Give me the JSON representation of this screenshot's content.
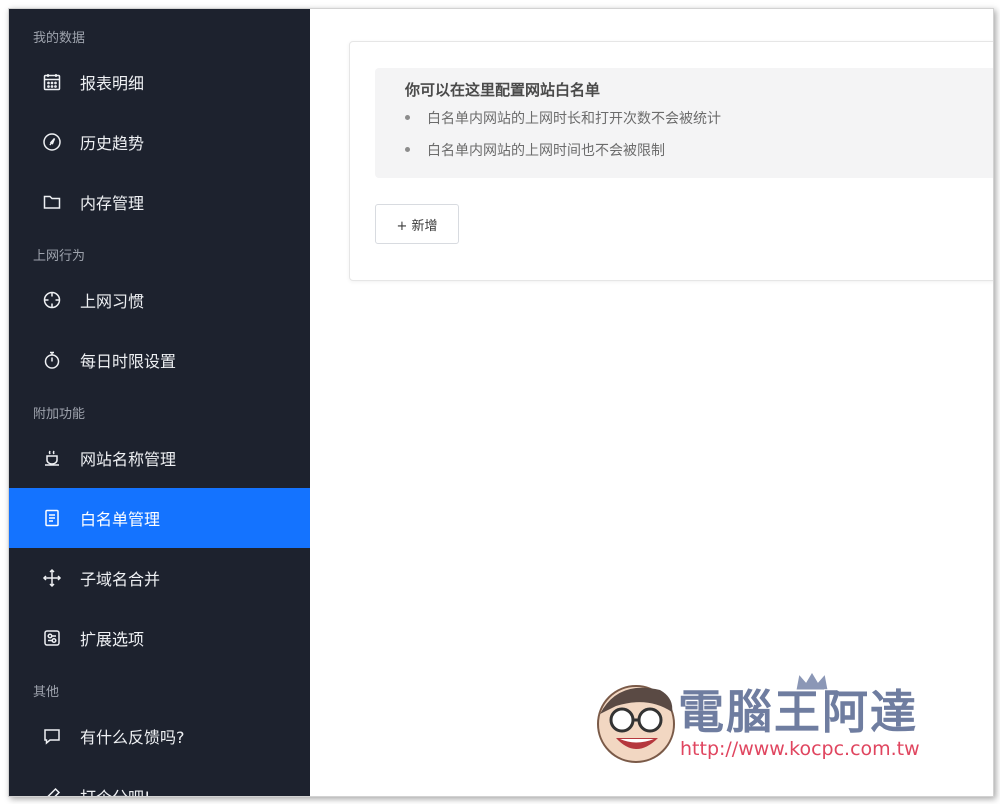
{
  "sidebar": {
    "groups": {
      "my_data": "我的数据",
      "browsing": "上网行为",
      "addons": "附加功能",
      "other": "其他"
    },
    "items": [
      {
        "label": "报表明细",
        "icon": "calendar-icon"
      },
      {
        "label": "历史趋势",
        "icon": "compass-icon"
      },
      {
        "label": "内存管理",
        "icon": "folder-icon"
      },
      {
        "label": "上网习惯",
        "icon": "crosshair-icon"
      },
      {
        "label": "每日时限设置",
        "icon": "stopwatch-icon"
      },
      {
        "label": "网站名称管理",
        "icon": "cup-icon"
      },
      {
        "label": "白名单管理",
        "icon": "document-icon"
      },
      {
        "label": "子域名合并",
        "icon": "move-icon"
      },
      {
        "label": "扩展选项",
        "icon": "settings-box-icon"
      },
      {
        "label": "有什么反馈吗?",
        "icon": "chat-icon"
      },
      {
        "label": "打个分吧!",
        "icon": "pencil-icon"
      }
    ],
    "active_index": 6,
    "colors": {
      "background": "#1d222e",
      "active": "#1473ff"
    }
  },
  "main": {
    "info": {
      "title": "你可以在这里配置网站白名单",
      "lines": [
        "白名单内网站的上网时长和打开次数不会被统计",
        "白名单内网站的上网时间也不会被限制"
      ]
    },
    "add_button": "+ 新增"
  },
  "watermark": {
    "title": "電腦王阿達",
    "url": "http://www.kocpc.com.tw"
  }
}
